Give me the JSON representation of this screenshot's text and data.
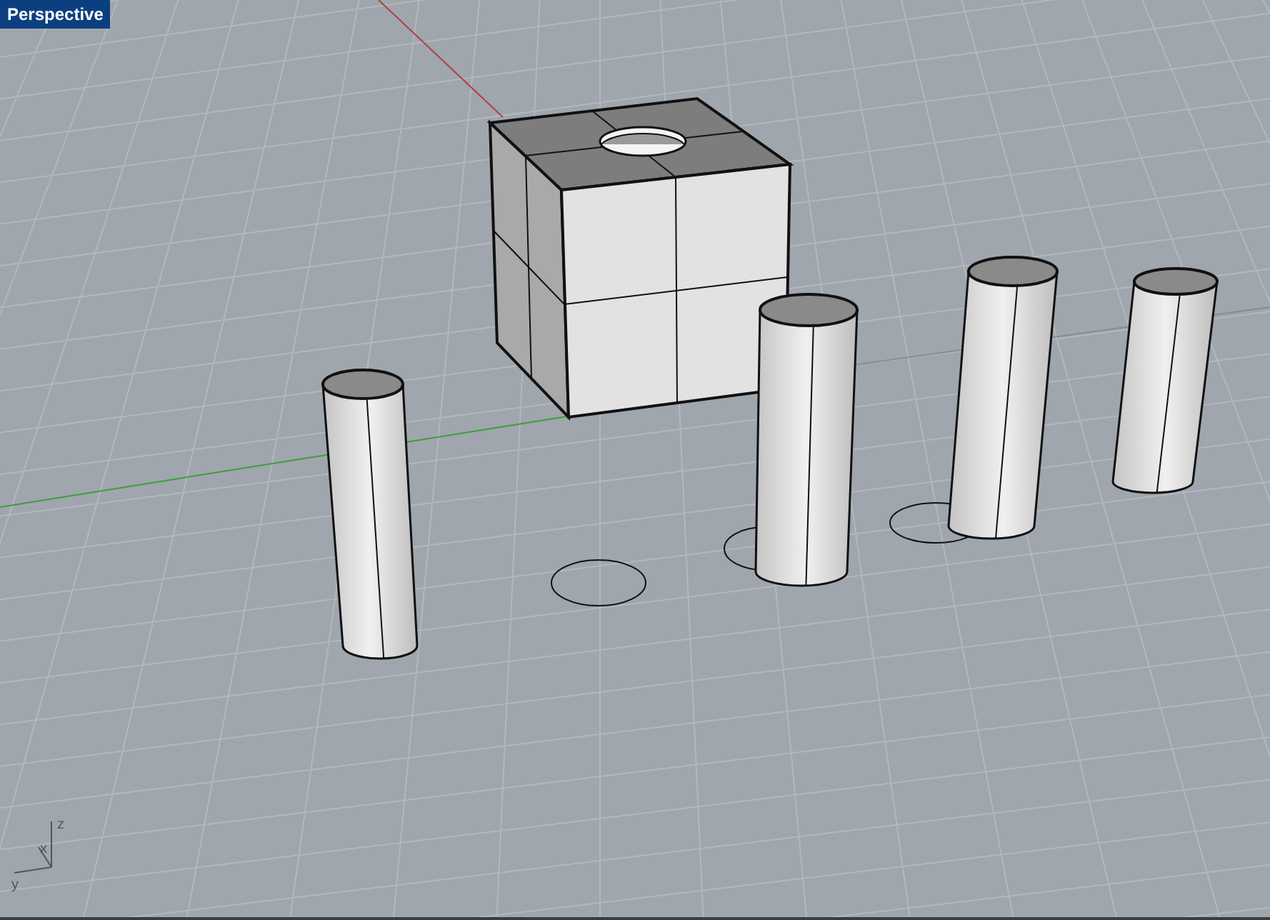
{
  "viewport": {
    "title": "Perspective"
  },
  "axis_labels": [
    {
      "label": "z"
    },
    {
      "label": "x"
    },
    {
      "label": "y"
    }
  ]
}
